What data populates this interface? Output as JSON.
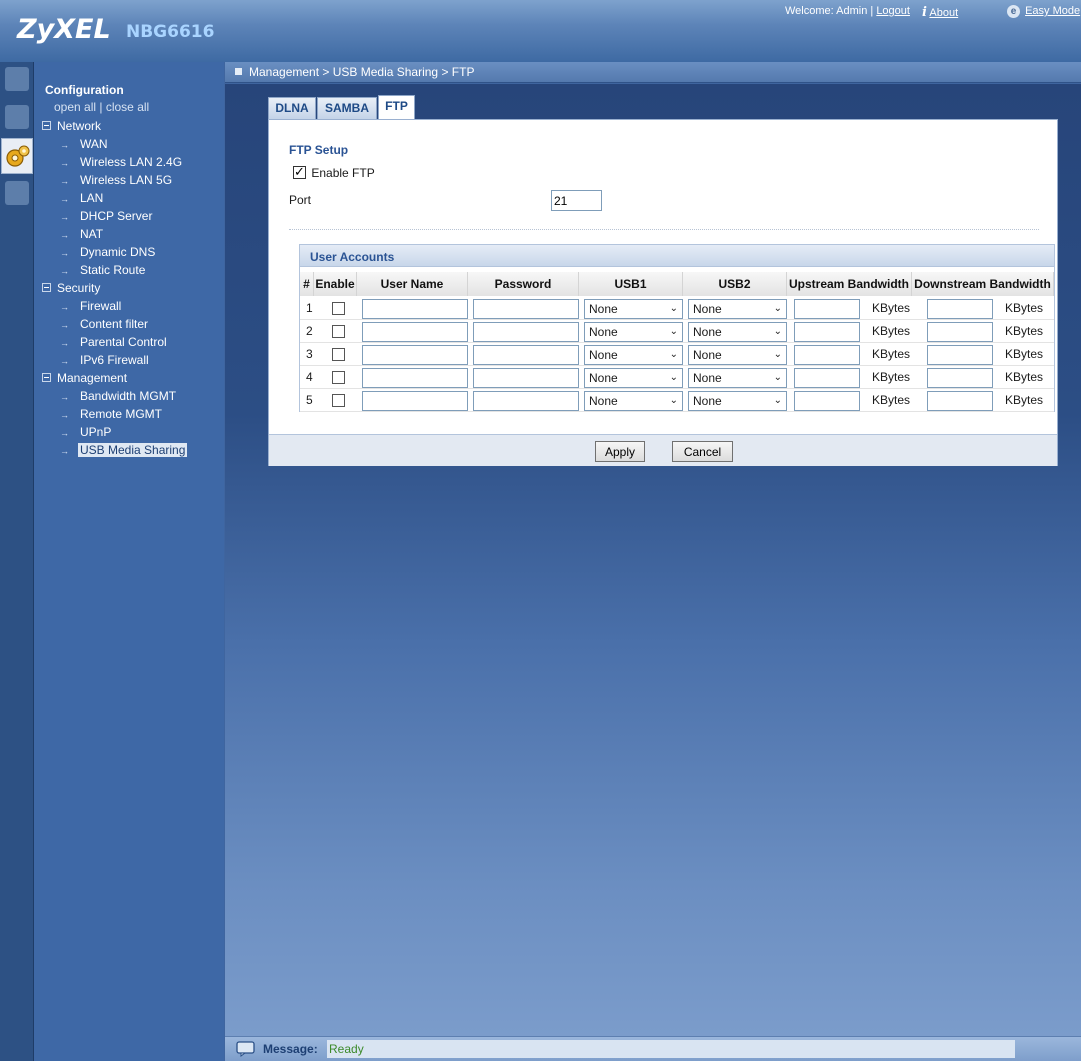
{
  "header": {
    "brand": "ZyXEL",
    "model": "NBG6616",
    "welcome": "Welcome: Admin",
    "separator": "|",
    "logout": "Logout",
    "about": "About",
    "easy_mode": "Easy Mode"
  },
  "menu": {
    "title": "Configuration",
    "open_all": "open all",
    "close_all": "| close all",
    "groups": [
      {
        "label": "Network",
        "items": [
          "WAN",
          "Wireless LAN 2.4G",
          "Wireless LAN 5G",
          "LAN",
          "DHCP Server",
          "NAT",
          "Dynamic DNS",
          "Static Route"
        ]
      },
      {
        "label": "Security",
        "items": [
          "Firewall",
          "Content filter",
          "Parental Control",
          "IPv6 Firewall"
        ]
      },
      {
        "label": "Management",
        "items": [
          "Bandwidth MGMT",
          "Remote MGMT",
          "UPnP",
          "USB Media Sharing"
        ]
      }
    ],
    "selected": "USB Media Sharing"
  },
  "breadcrumb": "Management > USB Media Sharing > FTP",
  "tabs": [
    {
      "label": "DLNA",
      "active": false
    },
    {
      "label": "SAMBA",
      "active": false
    },
    {
      "label": "FTP",
      "active": true
    }
  ],
  "ftp_setup": {
    "title": "FTP Setup",
    "enable_label": "Enable FTP",
    "enabled": true,
    "port_label": "Port",
    "port_value": "21"
  },
  "accounts": {
    "title": "User Accounts",
    "headers": [
      "#",
      "Enable",
      "User Name",
      "Password",
      "USB1",
      "USB2",
      "Upstream Bandwidth",
      "Downstream Bandwidth"
    ],
    "unit": "KBytes",
    "rows": [
      {
        "num": "1",
        "usb1": "None",
        "usb2": "None"
      },
      {
        "num": "2",
        "usb1": "None",
        "usb2": "None"
      },
      {
        "num": "3",
        "usb1": "None",
        "usb2": "None"
      },
      {
        "num": "4",
        "usb1": "None",
        "usb2": "None"
      },
      {
        "num": "5",
        "usb1": "None",
        "usb2": "None"
      }
    ]
  },
  "buttons": {
    "apply": "Apply",
    "cancel": "Cancel"
  },
  "message": {
    "label": "Message:",
    "value": "Ready"
  },
  "colors": {
    "accent": "#2a5394",
    "status_ok": "#3c8a2a",
    "sidebar": "#3e68a6"
  }
}
